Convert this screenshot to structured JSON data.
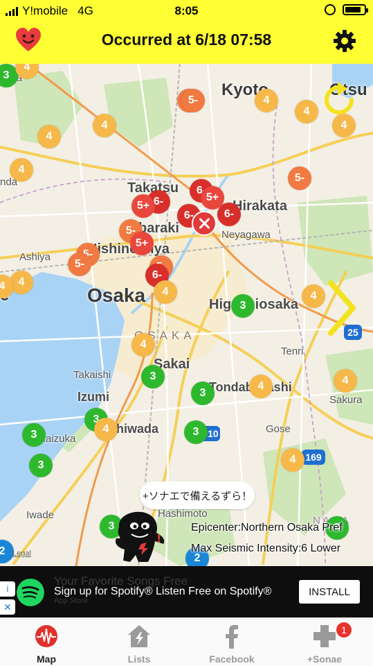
{
  "status_bar": {
    "carrier": "Y!mobile",
    "network": "4G",
    "time": "8:05",
    "battery_level": 0.85
  },
  "header": {
    "title": "Occurred at 6/18 07:58"
  },
  "map": {
    "places": {
      "kyoto": "Kyoto",
      "otsu": "Otsu",
      "takatsuki": "Takatsu",
      "ibaraki": "baraki",
      "hirakata": "Hirakata",
      "neyagawa": "Neyagawa",
      "nishinomiya": "Nishinomiya",
      "ashiya": "Ashiya",
      "osaka": "Osaka",
      "higashiosaka": "Higashiosaka",
      "osaka_pref": "OSAKA",
      "sakai": "Sakai",
      "tenri": "Tenri",
      "takaishi": "Takaishi",
      "izumi": "Izumi",
      "tondabayashi": "Tondabayashi",
      "sakurai": "Sakura",
      "kishiwada": "Kishiwada",
      "kaizuka": "Kaizuka",
      "gose": "Gose",
      "iwade": "Iwade",
      "hashimoto": "Hashimoto",
      "nda": "nda",
      "ida": "ida",
      "e": "e",
      "nara": "N A R A"
    },
    "highway_shields": {
      "route25": "25",
      "route310": "310",
      "route169": "169"
    },
    "intensity_labels": {
      "i2": "2",
      "i3": "3",
      "i4": "4",
      "i5m": "5-",
      "i5p": "5+",
      "i6m": "6-"
    },
    "speech_bubble": "+ソナエで備えるずら！",
    "epicenter_text": "Epicenter:Northern Osaka Pref",
    "max_intensity_text": "Max Seismic Intensity:6 Lower",
    "legal": "Legal",
    "colors": {
      "i2": "#1b86d6",
      "i3": "#2eb82e",
      "i4": "#f7b84a",
      "i5m": "#f07a42",
      "i5p": "#e9473d",
      "i6m": "#d92f2a",
      "epicenter": "#e23a3a"
    }
  },
  "ad": {
    "ghost_line": "Your Favorite Songs Free",
    "ghost_store": "App Store",
    "text": "Sign up for Spotify® Listen Free on Spotify®",
    "cta": "INSTALL"
  },
  "tabs": [
    {
      "label": "Map",
      "icon": "seismograph-icon",
      "active": true
    },
    {
      "label": "Lists",
      "icon": "lightning-house-icon",
      "active": false
    },
    {
      "label": "Facebook",
      "icon": "facebook-icon",
      "active": false
    },
    {
      "label": "+Sonae",
      "icon": "plus-icon",
      "active": false,
      "badge": "1"
    }
  ]
}
